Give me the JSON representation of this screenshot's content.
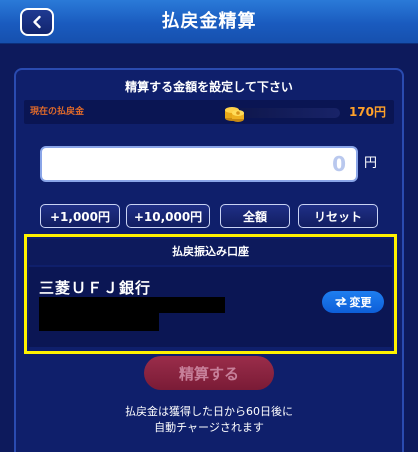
{
  "header": {
    "title": "払戻金精算",
    "back_icon": "chevron-left-icon"
  },
  "panel": {
    "title": "精算する金額を設定して下さい",
    "balance": {
      "label": "現在の払戻金",
      "value": "170円",
      "icon": "coin-stack-icon"
    },
    "amount_input": {
      "value": "0",
      "unit": "円"
    },
    "quick_buttons": [
      {
        "label": "+1,000円"
      },
      {
        "label": "+10,000円"
      },
      {
        "label": "全額"
      },
      {
        "label": "リセット"
      }
    ],
    "account": {
      "header": "払戻振込み口座",
      "bank_name": "三菱ＵＦＪ銀行",
      "change_label": "変更",
      "change_icon": "swap-arrows-icon"
    },
    "settle_label": "精算する",
    "note_line1": "払戻金は獲得した日から60日後に",
    "note_line2": "自動チャージされます"
  },
  "colors": {
    "header": "#1a5bbf",
    "background": "#0d1a5c",
    "panel": "#0f1f6b",
    "accent_orange": "#ffa12a",
    "highlight": "#fff200",
    "settle_button": "#8a2440",
    "change_button": "#1570e8"
  }
}
